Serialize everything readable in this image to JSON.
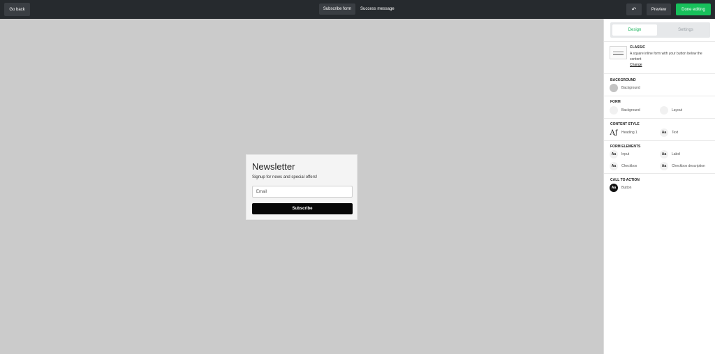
{
  "topbar": {
    "go_back": "Go back",
    "tab_subscribe": "Subscribe form",
    "tab_success": "Success message",
    "undo_icon": "↶",
    "preview": "Preview",
    "done": "Done editing"
  },
  "form": {
    "title": "Newsletter",
    "subtitle": "Signup for news and special offers!",
    "email_placeholder": "Email",
    "submit": "Subscribe"
  },
  "panel": {
    "tabs": {
      "design": "Design",
      "settings": "Settings"
    },
    "template": {
      "name": "CLASSIC",
      "description": "A square inline form with your button below the content",
      "change": "Change"
    },
    "background": {
      "title": "BACKGROUND",
      "item": "Background"
    },
    "form_section": {
      "title": "FORM",
      "background": "Background",
      "layout": "Layout"
    },
    "content_style": {
      "title": "CONTENT STYLE",
      "heading": "Heading 1",
      "text": "Text",
      "aa": "Aa",
      "af": "Aƒ"
    },
    "form_elements": {
      "title": "FORM ELEMENTS",
      "input": "Input",
      "label": "Label",
      "checkbox": "Checkbox",
      "checkbox_desc": "Checkbox description",
      "aa": "Aa"
    },
    "cta": {
      "title": "CALL TO ACTION",
      "button": "Button",
      "aa": "Aa"
    }
  },
  "colors": {
    "accent": "#17c05b",
    "topbar": "#262a2e",
    "canvas": "#cbcbcb"
  }
}
